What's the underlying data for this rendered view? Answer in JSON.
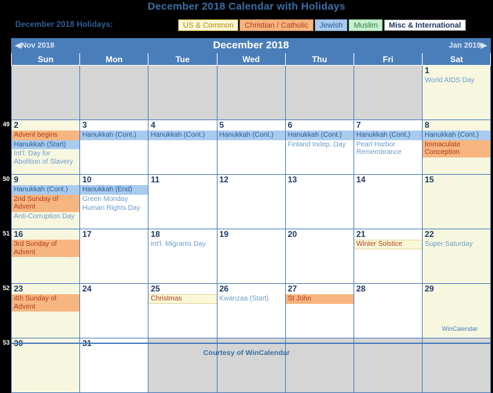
{
  "page_title": "December 2018 Calendar with Holidays",
  "legend": {
    "label": "December 2018 Holidays:",
    "chips": [
      {
        "name": "us-common",
        "label": "US & Common",
        "bg": "#fbf8d8",
        "fg": "#b8860b"
      },
      {
        "name": "christian-catholic",
        "label": "Christian / Catholic",
        "bg": "#f7b580",
        "fg": "#b03a1a"
      },
      {
        "name": "jewish",
        "label": "Jewish",
        "bg": "#a8cbee",
        "fg": "#2a5c93"
      },
      {
        "name": "muslim",
        "label": "Muslim",
        "bg": "#c8f0cd",
        "fg": "#2a7a44"
      },
      {
        "name": "misc-international",
        "label": "Misc & International",
        "bg": "#ffffff",
        "fg": "#1f3864"
      }
    ]
  },
  "nav": {
    "prev": "◀Nov 2018",
    "title": "December 2018",
    "next": "Jan 2019▶"
  },
  "dow": [
    "Sun",
    "Mon",
    "Tue",
    "Wed",
    "Thu",
    "Fri",
    "Sat"
  ],
  "week_numbers": [
    "",
    "49",
    "50",
    "51",
    "52",
    "53"
  ],
  "weeks": [
    [
      {
        "day": "",
        "blank": true,
        "events": []
      },
      {
        "day": "",
        "blank": true,
        "events": []
      },
      {
        "day": "",
        "blank": true,
        "events": []
      },
      {
        "day": "",
        "blank": true,
        "events": []
      },
      {
        "day": "",
        "blank": true,
        "events": []
      },
      {
        "day": "",
        "blank": true,
        "events": []
      },
      {
        "day": "1",
        "blank": false,
        "events": [
          {
            "text": "World AIDS Day",
            "cat": "misc"
          }
        ]
      }
    ],
    [
      {
        "day": "2",
        "blank": false,
        "events": [
          {
            "text": "Advent begins",
            "cat": "christian"
          },
          {
            "text": "Hanukkah (Start)",
            "cat": "jewish"
          },
          {
            "text": "Int'l. Day for Abolition of Slavery",
            "cat": "misc"
          }
        ]
      },
      {
        "day": "3",
        "blank": false,
        "events": [
          {
            "text": "Hanukkah (Cont.)",
            "cat": "jewish"
          }
        ]
      },
      {
        "day": "4",
        "blank": false,
        "events": [
          {
            "text": "Hanukkah (Cont.)",
            "cat": "jewish"
          }
        ]
      },
      {
        "day": "5",
        "blank": false,
        "events": [
          {
            "text": "Hanukkah (Cont.)",
            "cat": "jewish"
          }
        ]
      },
      {
        "day": "6",
        "blank": false,
        "events": [
          {
            "text": "Hanukkah (Cont.)",
            "cat": "jewish"
          },
          {
            "text": "Finland Indep. Day",
            "cat": "misc"
          }
        ]
      },
      {
        "day": "7",
        "blank": false,
        "events": [
          {
            "text": "Hanukkah (Cont.)",
            "cat": "jewish"
          },
          {
            "text": "Pearl Harbor Remembrance",
            "cat": "misc"
          }
        ]
      },
      {
        "day": "8",
        "blank": false,
        "events": [
          {
            "text": "Hanukkah (Cont.)",
            "cat": "jewish"
          },
          {
            "text": "Immaculate Conception",
            "cat": "christian"
          }
        ]
      }
    ],
    [
      {
        "day": "9",
        "blank": false,
        "events": [
          {
            "text": "Hanukkah (Cont.)",
            "cat": "jewish"
          },
          {
            "text": "2nd Sunday of Advent",
            "cat": "christian"
          },
          {
            "text": "Anti-Corruption Day",
            "cat": "misc"
          }
        ]
      },
      {
        "day": "10",
        "blank": false,
        "events": [
          {
            "text": "Hanukkah (End)",
            "cat": "jewish"
          },
          {
            "text": "Green Monday",
            "cat": "misc"
          },
          {
            "text": "Human Rights Day",
            "cat": "misc"
          }
        ]
      },
      {
        "day": "11",
        "blank": false,
        "events": []
      },
      {
        "day": "12",
        "blank": false,
        "events": []
      },
      {
        "day": "13",
        "blank": false,
        "events": []
      },
      {
        "day": "14",
        "blank": false,
        "events": []
      },
      {
        "day": "15",
        "blank": false,
        "events": []
      }
    ],
    [
      {
        "day": "16",
        "blank": false,
        "events": [
          {
            "text": "3rd Sunday of Advent",
            "cat": "christian"
          }
        ]
      },
      {
        "day": "17",
        "blank": false,
        "events": []
      },
      {
        "day": "18",
        "blank": false,
        "events": [
          {
            "text": "Int'l. Migrants Day",
            "cat": "misc"
          }
        ]
      },
      {
        "day": "19",
        "blank": false,
        "events": []
      },
      {
        "day": "20",
        "blank": false,
        "events": []
      },
      {
        "day": "21",
        "blank": false,
        "events": [
          {
            "text": "Winter Solstice",
            "cat": "us"
          }
        ]
      },
      {
        "day": "22",
        "blank": false,
        "events": [
          {
            "text": "Super Saturday",
            "cat": "misc"
          }
        ]
      }
    ],
    [
      {
        "day": "23",
        "blank": false,
        "events": [
          {
            "text": "4th Sunday of Advent",
            "cat": "christian"
          }
        ]
      },
      {
        "day": "24",
        "blank": false,
        "events": []
      },
      {
        "day": "25",
        "blank": false,
        "events": [
          {
            "text": "Christmas",
            "cat": "us"
          }
        ]
      },
      {
        "day": "26",
        "blank": false,
        "events": [
          {
            "text": "Kwanzaa (Start)",
            "cat": "misc"
          }
        ]
      },
      {
        "day": "27",
        "blank": false,
        "events": [
          {
            "text": "St John",
            "cat": "christian"
          }
        ]
      },
      {
        "day": "28",
        "blank": false,
        "events": []
      },
      {
        "day": "29",
        "blank": false,
        "events": []
      }
    ],
    [
      {
        "day": "30",
        "blank": false,
        "events": []
      },
      {
        "day": "31",
        "blank": false,
        "events": []
      },
      {
        "day": "",
        "blank": true,
        "events": []
      },
      {
        "day": "",
        "blank": true,
        "events": []
      },
      {
        "day": "",
        "blank": true,
        "events": []
      },
      {
        "day": "",
        "blank": true,
        "events": []
      },
      {
        "day": "",
        "blank": true,
        "events": []
      }
    ]
  ],
  "footer": {
    "brand": "WinCalendar",
    "courtesy": "Courtesy of WinCalendar"
  }
}
